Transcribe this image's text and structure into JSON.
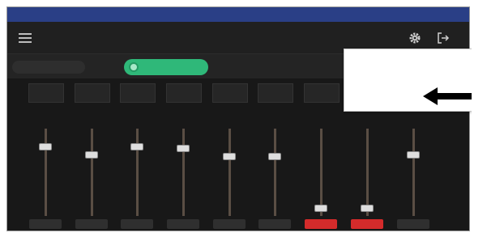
{
  "status_bar": {
    "left": "",
    "right": ""
  },
  "header": {
    "device_line_1": "",
    "device_line_2": "",
    "model_line_1": "",
    "model_line_2": "",
    "preset": "",
    "icons": [
      "menu-icon",
      "gear-icon",
      "exit-icon"
    ]
  },
  "toolbar": {
    "settings_label": "",
    "connect_label": ""
  },
  "dropdown": {
    "items": [
      {
        "label": ""
      },
      {
        "label": ""
      }
    ]
  },
  "mixer": {
    "channels": [
      {
        "name": "",
        "value": "",
        "level": 0.82,
        "mute": "",
        "active": false
      },
      {
        "name": "",
        "value": "",
        "level": 0.72,
        "mute": "",
        "active": false
      },
      {
        "name": "",
        "value": "",
        "level": 0.82,
        "mute": "",
        "active": false
      },
      {
        "name": "",
        "value": "",
        "level": 0.8,
        "mute": "",
        "active": false
      },
      {
        "name": "",
        "value": "",
        "level": 0.7,
        "mute": "",
        "active": false
      },
      {
        "name": "",
        "value": "",
        "level": 0.7,
        "mute": "",
        "active": false
      },
      {
        "name": "",
        "value": "",
        "level": 0.05,
        "mute": "",
        "active": true
      },
      {
        "name": "",
        "value": "",
        "level": 0.05,
        "mute": "",
        "active": true
      },
      {
        "name": "",
        "value": "",
        "level": 0.72,
        "mute": "",
        "active": false
      }
    ]
  },
  "colors": {
    "frame": "#1f1f1f",
    "status_bar": "#2a3f86",
    "connect": "#2fb879",
    "mute_active": "#d42b2b",
    "dropdown_bg": "#ffffff",
    "pointer_arrow": "#000000"
  }
}
